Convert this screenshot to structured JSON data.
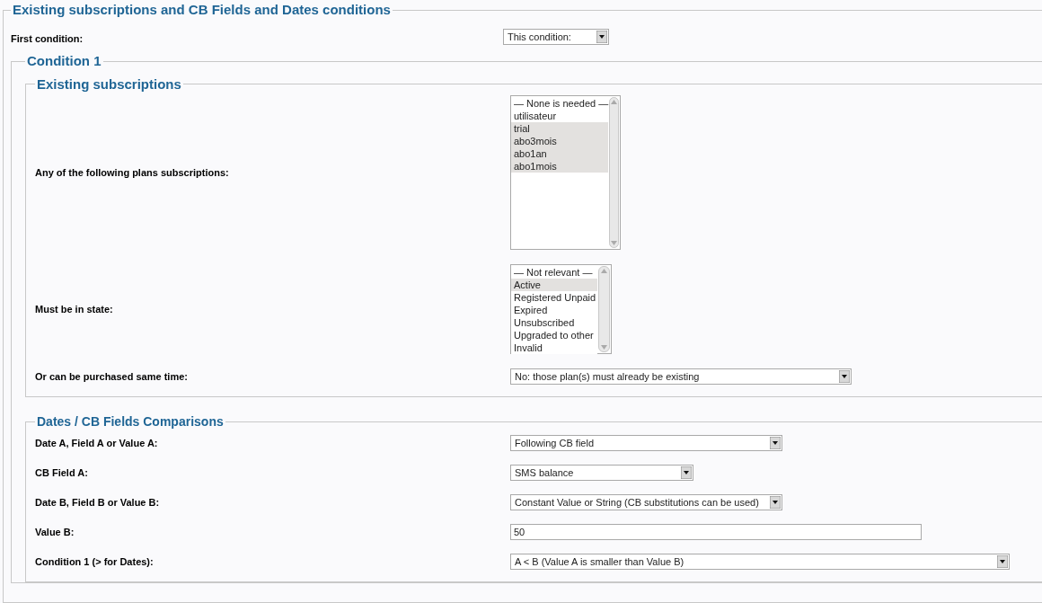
{
  "title": "Existing subscriptions and CB Fields and Dates conditions",
  "first_condition": {
    "label": "First condition:",
    "value": "This condition:"
  },
  "condition": {
    "legend": "Condition 1",
    "subscriptions": {
      "legend": "Existing subscriptions",
      "rows": [
        {
          "kind": "listbox",
          "label": "Any of the following plans subscriptions:",
          "options": [
            {
              "label": "— None is needed —",
              "selected": false
            },
            {
              "label": "utilisateur",
              "selected": false
            },
            {
              "label": "trial",
              "selected": true
            },
            {
              "label": "abo3mois",
              "selected": true
            },
            {
              "label": "abo1an",
              "selected": true
            },
            {
              "label": "abo1mois",
              "selected": true
            }
          ]
        },
        {
          "kind": "listbox",
          "label": "Must be in state:",
          "options": [
            {
              "label": "— Not relevant —",
              "selected": false
            },
            {
              "label": "Active",
              "selected": true
            },
            {
              "label": "Registered Unpaid",
              "selected": false
            },
            {
              "label": "Expired",
              "selected": false
            },
            {
              "label": "Unsubscribed",
              "selected": false
            },
            {
              "label": "Upgraded to other",
              "selected": false
            },
            {
              "label": "Invalid",
              "selected": false
            }
          ]
        },
        {
          "kind": "select",
          "label": "Or can be purchased same time:",
          "value": "No: those plan(s) must already be existing"
        }
      ]
    },
    "comparisons": {
      "legend": "Dates / CB Fields Comparisons",
      "rows": [
        {
          "kind": "select",
          "label": "Date A, Field A or Value A:",
          "value": "Following CB field"
        },
        {
          "kind": "select",
          "label": "CB Field A:",
          "value": "SMS balance"
        },
        {
          "kind": "select",
          "label": "Date B, Field B or Value B:",
          "value": "Constant Value or String (CB substitutions can be used)"
        },
        {
          "kind": "input",
          "label": "Value B:",
          "value": "50"
        },
        {
          "kind": "select",
          "label": "Condition 1 (> for Dates):",
          "value": "A < B (Value A is smaller than Value B)"
        }
      ]
    }
  }
}
